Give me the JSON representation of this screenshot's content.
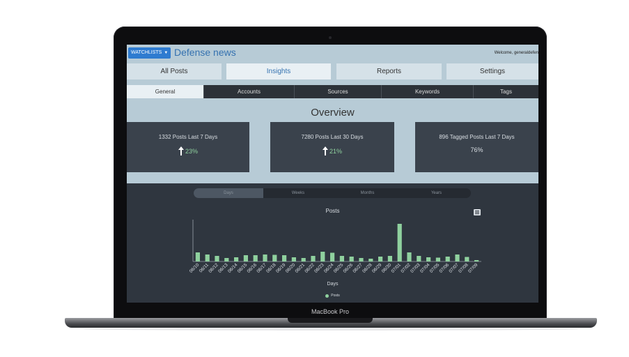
{
  "device": {
    "label": "MacBook Pro"
  },
  "header": {
    "watchlists_label": "WATCHLISTS",
    "app_title": "Defense news",
    "welcome_text": "Welcome, generaldefen"
  },
  "main_nav": [
    {
      "label": "All Posts",
      "active": false
    },
    {
      "label": "Insights",
      "active": true
    },
    {
      "label": "Reports",
      "active": false
    },
    {
      "label": "Settings",
      "active": false
    }
  ],
  "sub_nav": [
    {
      "label": "General",
      "active": true
    },
    {
      "label": "Accounts",
      "active": false
    },
    {
      "label": "Sources",
      "active": false
    },
    {
      "label": "Keywords",
      "active": false
    },
    {
      "label": "Tags",
      "active": false
    }
  ],
  "overview": {
    "title": "Overview",
    "cards": [
      {
        "label": "1332 Posts Last 7 Days",
        "value": "23%",
        "trend": "up"
      },
      {
        "label": "7280 Posts Last 30 Days",
        "value": "21%",
        "trend": "up"
      },
      {
        "label": "896 Tagged Posts Last 7 Days",
        "value": "76%",
        "trend": "none"
      }
    ]
  },
  "range_options": [
    {
      "label": "Days",
      "active": true
    },
    {
      "label": "Weeks",
      "active": false
    },
    {
      "label": "Months",
      "active": false
    },
    {
      "label": "Years",
      "active": false
    }
  ],
  "colors": {
    "accent": "#3572b0",
    "bar": "#8fd19e",
    "panel": "#2f363f"
  },
  "chart_data": {
    "type": "bar",
    "title": "Posts",
    "xlabel": "Days",
    "ylabel": "",
    "categories": [
      "06/10",
      "06/11",
      "06/12",
      "06/13",
      "06/14",
      "06/15",
      "06/16",
      "06/17",
      "06/18",
      "06/19",
      "06/20",
      "06/21",
      "06/22",
      "06/23",
      "06/24",
      "06/25",
      "06/26",
      "06/27",
      "06/28",
      "06/29",
      "06/30",
      "07/01",
      "07/02",
      "07/03",
      "07/04",
      "07/05",
      "07/06",
      "07/07",
      "07/08",
      "07/09"
    ],
    "series": [
      {
        "name": "Posts",
        "values": [
          130,
          100,
          80,
          50,
          60,
          90,
          90,
          100,
          95,
          90,
          60,
          50,
          80,
          140,
          125,
          80,
          70,
          50,
          40,
          70,
          80,
          540,
          130,
          80,
          60,
          55,
          70,
          100,
          65,
          20
        ]
      }
    ],
    "ylim": [
      0,
      600
    ],
    "legend_position": "bottom",
    "grid": false
  }
}
